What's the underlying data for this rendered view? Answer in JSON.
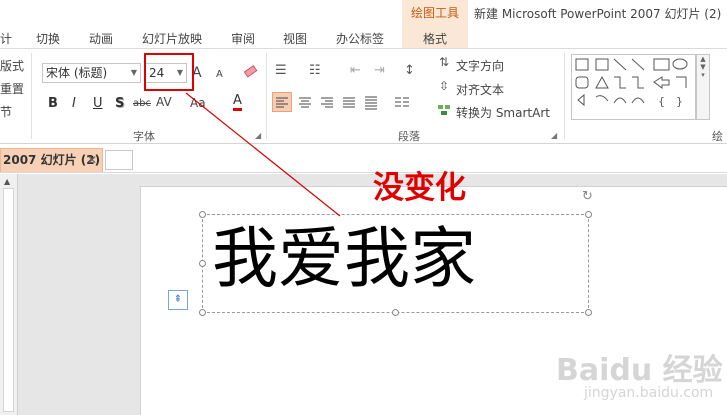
{
  "tabs": {
    "items": [
      {
        "label": "计"
      },
      {
        "label": "切换"
      },
      {
        "label": "动画"
      },
      {
        "label": "幻灯片放映"
      },
      {
        "label": "审阅"
      },
      {
        "label": "视图"
      },
      {
        "label": "办公标签"
      }
    ],
    "drawing_tools_group": "绘图工具",
    "format_tab": "格式",
    "window_title": "新建 Microsoft PowerPoint 2007 幻灯片 (2)"
  },
  "ribbon": {
    "slides_group": {
      "layout": "版式",
      "reset": "重置",
      "section": "节"
    },
    "font": {
      "name": "宋体 (标题)",
      "size": "24",
      "group_label": "字体",
      "bold": "B",
      "italic": "I",
      "underline": "U",
      "shadow": "S",
      "strike": "abc",
      "spacing": "AV",
      "change_case": "Aa",
      "color": "A",
      "grow": "A",
      "shrink": "A"
    },
    "paragraph": {
      "group_label": "段落",
      "text_direction": "文字方向",
      "align_text": "对齐文本",
      "convert_smartart": "转换为 SmartArt"
    },
    "drawing": {
      "group_label_partial": "绘"
    }
  },
  "document_tab": {
    "label": "2007 幻灯片 (2)",
    "close": "✕"
  },
  "slide": {
    "text": "我爱我家"
  },
  "annotation": {
    "text": "没变化",
    "color": "#e00000"
  },
  "watermark": {
    "text": "Baidu 经验",
    "url": "jingyan.baidu.com"
  },
  "colors": {
    "accent_orange": "#c55a11",
    "drawing_tools_bg": "#fbe7d6",
    "doc_tab_bg": "#f7d0b5",
    "highlight_red": "#e00000"
  }
}
